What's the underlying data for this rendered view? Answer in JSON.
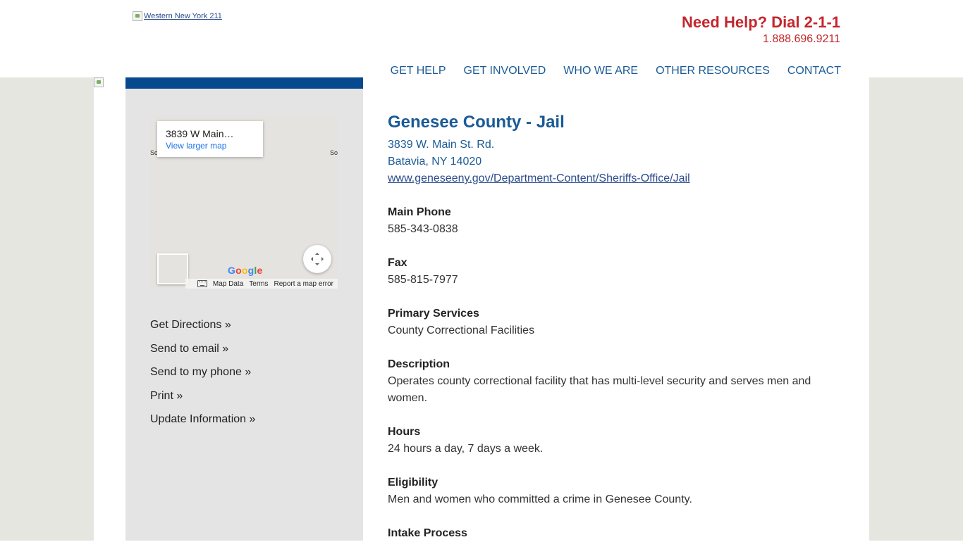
{
  "header": {
    "logo_alt": "Western New York 211",
    "help_title": "Need Help? Dial 2-1-1",
    "help_phone": "1.888.696.9211",
    "nav": [
      "GET HELP",
      "GET INVOLVED",
      "WHO WE ARE",
      "OTHER RESOURCES",
      "CONTACT"
    ]
  },
  "map": {
    "card_title": "3839 W Main…",
    "card_link": "View larger map",
    "edge_left": "So",
    "edge_right": "So",
    "footer": [
      "Map Data",
      "Terms",
      "Report a map error"
    ]
  },
  "sidebar": {
    "links": [
      "Get Directions »",
      "Send to email »",
      "Send to my phone »",
      "Print »",
      "Update Information »"
    ]
  },
  "listing": {
    "title": "Genesee County - Jail",
    "address_line1": "3839 W. Main St. Rd.",
    "address_line2": "Batavia, NY 14020",
    "url": "www.geneseeny.gov/Department-Content/Sheriffs-Office/Jail",
    "sections": [
      {
        "label": "Main Phone",
        "value": "585-343-0838"
      },
      {
        "label": "Fax",
        "value": "585-815-7977"
      },
      {
        "label": "Primary Services",
        "value": "County Correctional Facilities"
      },
      {
        "label": "Description",
        "value": "Operates county correctional facility that has multi-level security and serves men and women."
      },
      {
        "label": "Hours",
        "value": "24 hours a day, 7 days a week."
      },
      {
        "label": "Eligibility",
        "value": "Men and women who committed a crime in Genesee County."
      },
      {
        "label": "Intake Process",
        "value": ""
      }
    ]
  },
  "colors": {
    "brand_blue": "#1a5a96",
    "bar_blue": "#06498f",
    "help_red": "#c3262c",
    "sidebar_bg": "#e4e4e4",
    "page_bg": "#e6e6e1"
  }
}
